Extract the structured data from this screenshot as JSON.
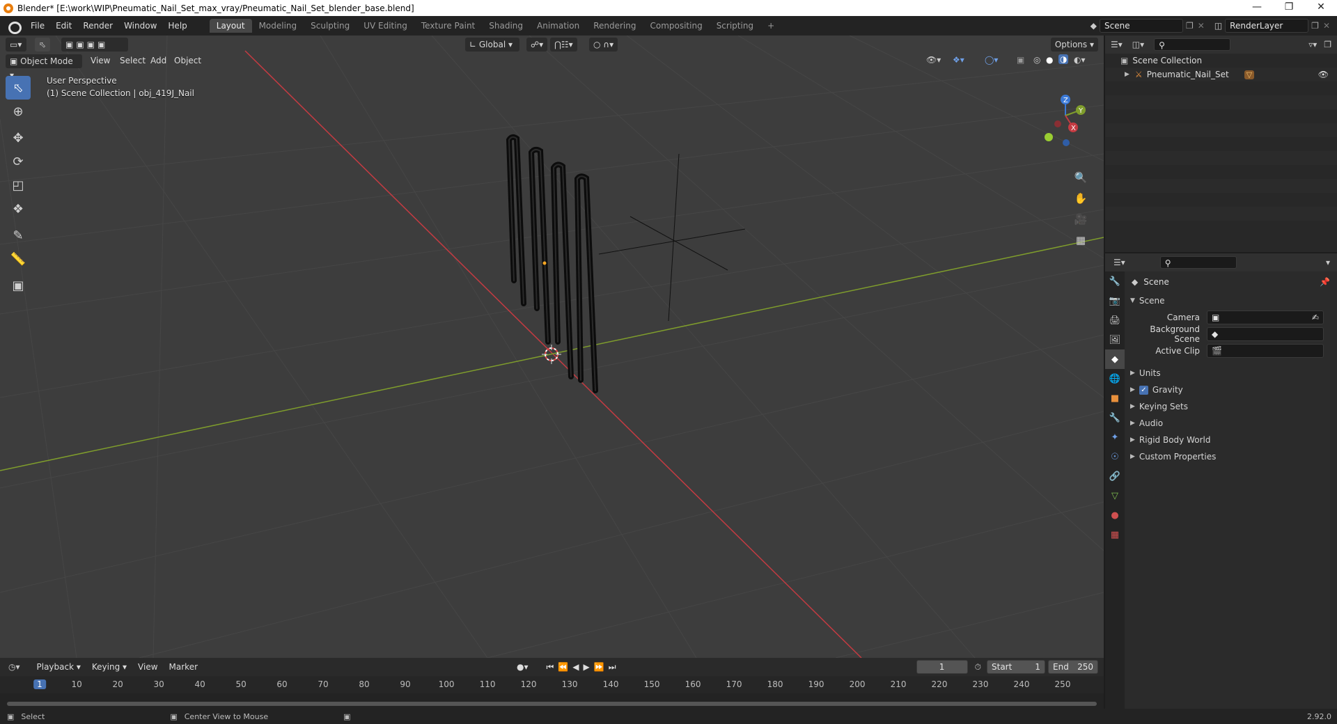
{
  "window": {
    "title": "Blender* [E:\\work\\WIP\\Pneumatic_Nail_Set_max_vray/Pneumatic_Nail_Set_blender_base.blend]",
    "controls": [
      "—",
      "❐",
      "✕"
    ]
  },
  "menu": [
    "File",
    "Edit",
    "Render",
    "Window",
    "Help"
  ],
  "workspaces": [
    "Layout",
    "Modeling",
    "Sculpting",
    "UV Editing",
    "Texture Paint",
    "Shading",
    "Animation",
    "Rendering",
    "Compositing",
    "Scripting"
  ],
  "active_workspace": "Layout",
  "scene_field": "Scene",
  "renderlayer_field": "RenderLayer",
  "viewport": {
    "mode": "Object Mode",
    "menus": [
      "View",
      "Select",
      "Add",
      "Object"
    ],
    "transform_orientation": "Global",
    "options_label": "Options",
    "overlay_line1": "User Perspective",
    "overlay_line2": "(1) Scene Collection | obj_419J_Nail",
    "gizmo": {
      "x": "X",
      "y": "Y",
      "z": "Z"
    }
  },
  "tools": [
    "select-box",
    "cursor",
    "move",
    "rotate",
    "scale",
    "transform",
    "annotate",
    "measure",
    "add-cube"
  ],
  "outliner": {
    "root": "Scene Collection",
    "items": [
      {
        "label": "Pneumatic_Nail_Set"
      }
    ]
  },
  "properties": {
    "context": "Scene",
    "panel_title": "Scene",
    "fields": [
      {
        "label": "Camera",
        "value": ""
      },
      {
        "label": "Background Scene",
        "value": ""
      },
      {
        "label": "Active Clip",
        "value": ""
      }
    ],
    "subpanels": [
      {
        "label": "Units",
        "checkbox": false
      },
      {
        "label": "Gravity",
        "checkbox": true
      },
      {
        "label": "Keying Sets",
        "checkbox": false
      },
      {
        "label": "Audio",
        "checkbox": false
      },
      {
        "label": "Rigid Body World",
        "checkbox": false
      },
      {
        "label": "Custom Properties",
        "checkbox": false
      }
    ]
  },
  "timeline": {
    "menus": [
      "Playback",
      "Keying",
      "View",
      "Marker"
    ],
    "current_frame": "1",
    "start_label": "Start",
    "start": "1",
    "end_label": "End",
    "end": "250",
    "ruler": [
      "1",
      "10",
      "20",
      "30",
      "40",
      "50",
      "60",
      "70",
      "80",
      "90",
      "100",
      "110",
      "120",
      "130",
      "140",
      "150",
      "160",
      "170",
      "180",
      "190",
      "200",
      "210",
      "220",
      "230",
      "240",
      "250"
    ]
  },
  "status": {
    "left": "Select",
    "middle": "Center View to Mouse",
    "version": "2.92.0"
  },
  "colors": {
    "accent": "#4772b3",
    "x_axis": "#c53b42",
    "y_axis": "#7f9d2c",
    "z_axis": "#3b79d6",
    "bg_viewport": "#3d3d3d"
  }
}
